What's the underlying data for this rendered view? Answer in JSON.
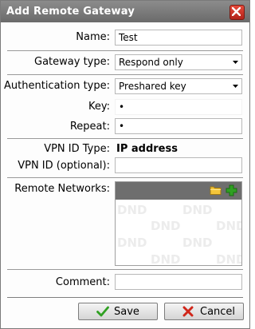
{
  "window": {
    "title": "Add Remote Gateway"
  },
  "form": {
    "name_label": "Name:",
    "name_value": "Test",
    "gateway_type_label": "Gateway type:",
    "gateway_type_value": "Respond only",
    "auth_type_label": "Authentication type:",
    "auth_type_value": "Preshared key",
    "key_label": "Key:",
    "key_value": "•",
    "repeat_label": "Repeat:",
    "repeat_value": "•",
    "vpn_id_type_label": "VPN ID Type:",
    "vpn_id_type_value": "IP address",
    "vpn_id_label": "VPN ID (optional):",
    "vpn_id_value": "",
    "remote_networks_label": "Remote Networks:",
    "remote_networks_watermark": "DND",
    "comment_label": "Comment:",
    "comment_value": ""
  },
  "buttons": {
    "save": "Save",
    "cancel": "Cancel"
  },
  "icons": {
    "close": "close-icon",
    "folder": "folder-icon",
    "add": "add-icon",
    "save": "checkmark-icon",
    "cancel": "x-icon"
  },
  "colors": {
    "titlebar": "#7a7a7a",
    "add_green": "#2fa022",
    "cancel_red": "#d0261a"
  }
}
